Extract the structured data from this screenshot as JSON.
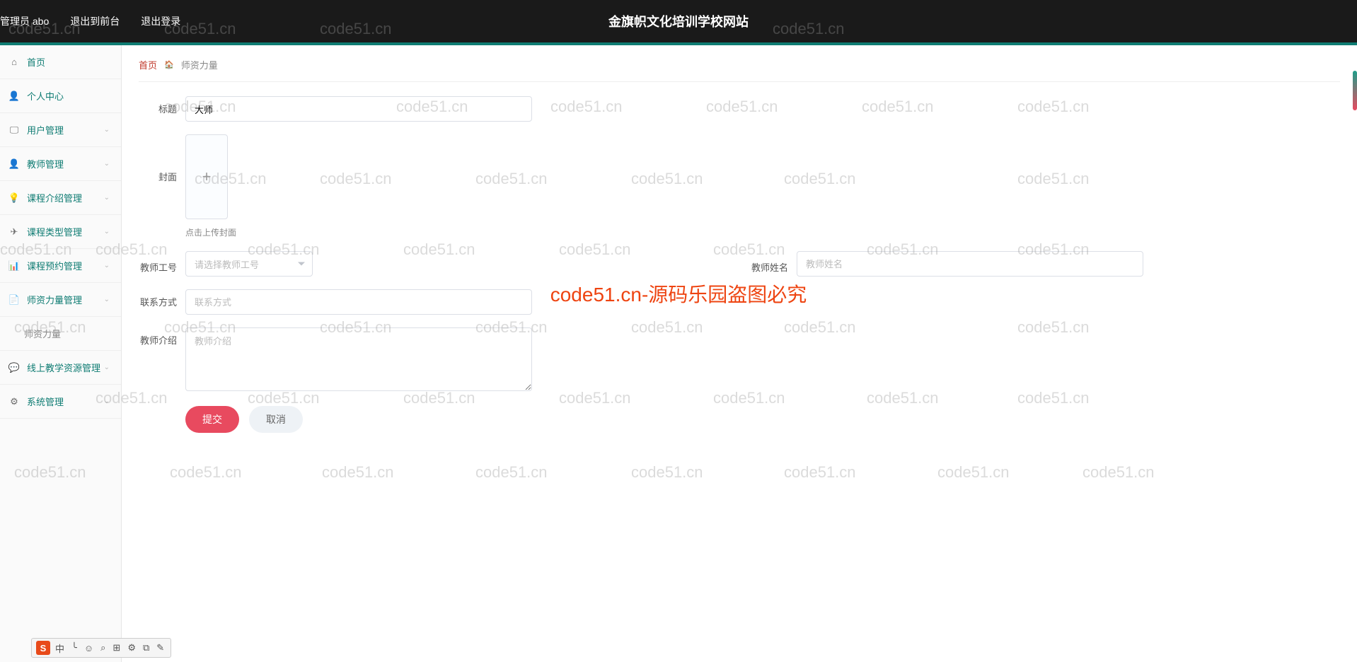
{
  "header": {
    "title": "金旗帜文化培训学校网站",
    "admin_label": "管理员 abo",
    "logout_front": "退出到前台",
    "logout": "退出登录"
  },
  "sidebar": {
    "items": [
      {
        "label": "首页",
        "icon": "home"
      },
      {
        "label": "个人中心",
        "icon": "user"
      },
      {
        "label": "用户管理",
        "icon": "monitor",
        "expandable": true
      },
      {
        "label": "教师管理",
        "icon": "person",
        "expandable": true
      },
      {
        "label": "课程介绍管理",
        "icon": "bulb",
        "expandable": true
      },
      {
        "label": "课程类型管理",
        "icon": "send",
        "expandable": true
      },
      {
        "label": "课程预约管理",
        "icon": "bars",
        "expandable": true
      },
      {
        "label": "师资力量管理",
        "icon": "doc",
        "expandable": true
      },
      {
        "label": "师资力量",
        "icon": "",
        "sub": true
      },
      {
        "label": "线上教学资源管理",
        "icon": "chat",
        "expandable": true
      },
      {
        "label": "系统管理",
        "icon": "gear",
        "expandable": true
      }
    ]
  },
  "breadcrumb": {
    "home": "首页",
    "current": "师资力量"
  },
  "form": {
    "title_label": "标题",
    "title_value": "大师",
    "cover_label": "封面",
    "cover_hint": "点击上传封面",
    "teacher_id_label": "教师工号",
    "teacher_id_placeholder": "请选择教师工号",
    "teacher_name_label": "教师姓名",
    "teacher_name_placeholder": "教师姓名",
    "contact_label": "联系方式",
    "contact_placeholder": "联系方式",
    "intro_label": "教师介绍",
    "intro_placeholder": "教师介绍",
    "submit": "提交",
    "cancel": "取消"
  },
  "watermark": {
    "text": "code51.cn",
    "center": "code51.cn-源码乐园盗图必究"
  },
  "ime": {
    "badge": "S",
    "items": [
      "中",
      "╰",
      "☺",
      "⌕",
      "⊞",
      "⚙",
      "⧉",
      "✎"
    ]
  }
}
